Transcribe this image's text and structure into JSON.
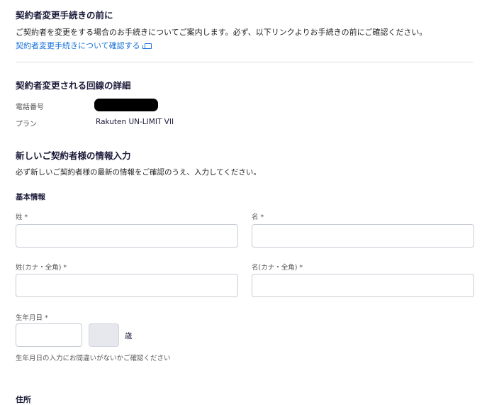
{
  "notice": {
    "title": "契約者変更手続きの前に",
    "description": "ご契約者を変更をする場合のお手続きについてご案内します。必ず、以下リンクよりお手続きの前にご確認ください。",
    "link_label": "契約者変更手続きについて確認する"
  },
  "line_details": {
    "title": "契約者変更される回線の詳細",
    "phone_label": "電話番号",
    "plan_label": "プラン",
    "plan_value": "Rakuten UN-LIMIT VII"
  },
  "new_contractor": {
    "title": "新しいご契約者様の情報入力",
    "description": "必ず新しいご契約者様の最新の情報をご確認のうえ、入力してください。"
  },
  "basic_info": {
    "title": "基本情報",
    "last_name_label": "姓 *",
    "first_name_label": "名 *",
    "last_name_kana_label": "姓(カナ・全角) *",
    "first_name_kana_label": "名(カナ・全角) *",
    "birthdate_label": "生年月日 *",
    "age_suffix": "歳",
    "birthdate_note": "生年月日の入力にお間違いがないかご確認ください"
  },
  "address": {
    "title": "住所"
  }
}
